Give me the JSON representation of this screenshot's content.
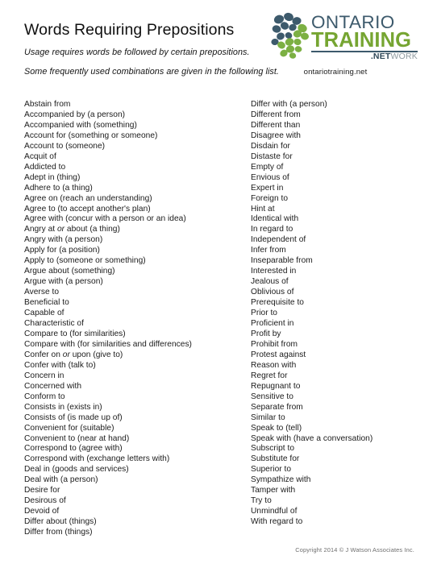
{
  "document": {
    "title": "Words Requiring Prepositions",
    "subtitle_1": "Usage requires words be followed by certain prepositions.",
    "subtitle_2": "Some frequently used combinations are given in the following list."
  },
  "logo": {
    "mark_name": "ontario-training-network-logo",
    "word_ontario": "ONTARIO",
    "word_training": "TRAINING",
    "word_net": ".NET",
    "word_work": "WORK",
    "url": "ontariotraining.net",
    "colors": {
      "navy": "#3d5a6c",
      "dark_navy": "#2f4858",
      "green": "#76a532",
      "gray": "#8e9aa0"
    }
  },
  "columns": {
    "left": [
      "Abstain from",
      "Accompanied by (a person)",
      "Accompanied with (something)",
      "Account for (something or someone)",
      "Account to (someone)",
      "Acquit of",
      "Addicted to",
      "Adept in (thing)",
      "Adhere to (a thing)",
      "Agree on (reach an understanding)",
      "Agree to (to accept another's plan)",
      "Agree with (concur with a person or an idea)",
      "Angry at <em>or</em> about (a thing)",
      "Angry with (a person)",
      "Apply for (a position)",
      "Apply to (someone or something)",
      "Argue about (something)",
      "Argue with (a person)",
      "Averse to",
      "Beneficial to",
      "Capable of",
      "Characteristic of",
      "Compare to (for similarities)",
      "Compare with (for similarities and differences)",
      "Confer on <em>or</em> upon (give to)",
      "Confer with (talk to)",
      "Concern in",
      "Concerned with",
      "Conform to",
      "Consists in (exists in)",
      "Consists of (is made up of)",
      "Convenient for (suitable)",
      "Convenient to (near at hand)",
      "Correspond to (agree with)",
      "Correspond with (exchange letters with)",
      "Deal in (goods and services)",
      "Deal with (a person)",
      "Desire for",
      "Desirous of",
      "Devoid of",
      "Differ about (things)",
      "Differ from (things)"
    ],
    "right": [
      "Differ with (a person)",
      "Different from",
      "Different than",
      "Disagree with",
      "Disdain for",
      "Distaste for",
      "Empty of",
      "Envious of",
      "Expert in",
      "Foreign to",
      "Hint at",
      "Identical with",
      "In regard to",
      "Independent of",
      "Infer from",
      "Inseparable from",
      "Interested in",
      "Jealous of",
      "Oblivious of",
      "Prerequisite to",
      "Prior to",
      "Proficient in",
      "Profit by",
      "Prohibit from",
      "Protest against",
      "Reason with",
      "Regret for",
      "Repugnant to",
      "Sensitive to",
      "Separate from",
      "Similar to",
      "Speak to (tell)",
      "Speak with (have a conversation)",
      "Subscript to",
      "Substitute for",
      "Superior to",
      "Sympathize with",
      "Tamper with",
      "Try to",
      "Unmindful of",
      "With regard to"
    ]
  },
  "footer": {
    "copyright": "Copyright 2014 © J Watson Associates Inc."
  }
}
